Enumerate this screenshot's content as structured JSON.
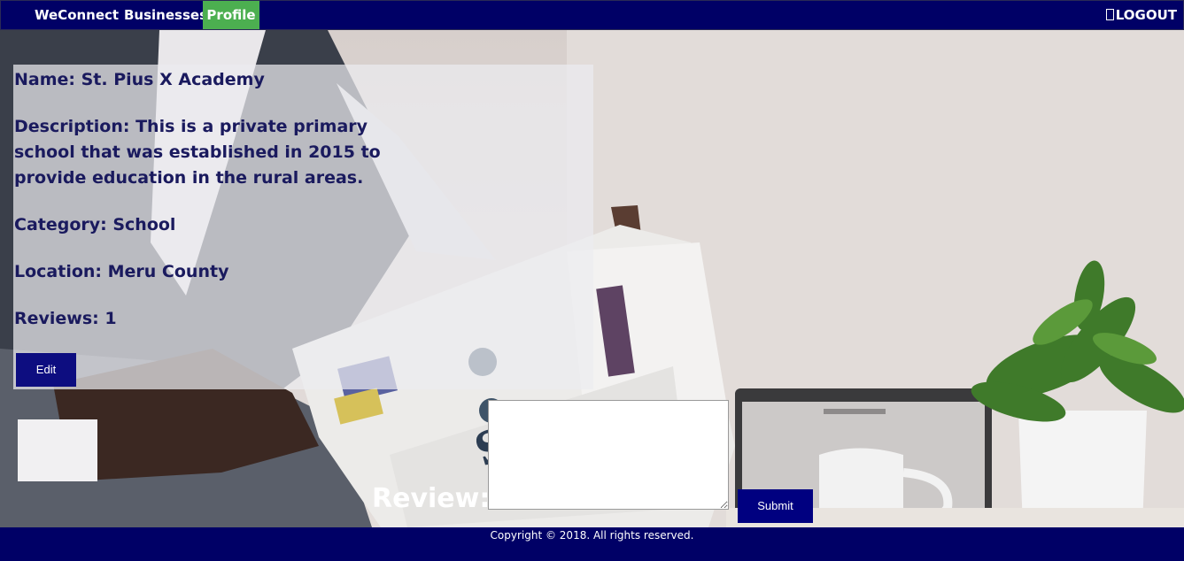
{
  "nav": {
    "brand": "WeConnect",
    "businesses": "Businesses",
    "profile": "Profile",
    "logout": "LOGOUT",
    "logout_icon": "box-glyph"
  },
  "business": {
    "name_line": "Name: St. Pius X Academy",
    "description_line": "Description: This is a private primary school that was established in 2015 to provide education in the rural areas.",
    "category_line": "Category: School",
    "location_line": "Location: Meru County",
    "reviews_line": "Reviews: 1",
    "edit_label": "Edit"
  },
  "review_form": {
    "label": "Review:",
    "textarea_value": "",
    "submit_label": "Submit"
  },
  "footer": {
    "copyright": "Copyright © 2018. All rights reserved."
  },
  "colors": {
    "nav_bg": "#000066",
    "active_tab": "#4caf50",
    "button_bg": "#000080",
    "panel_text": "#1a1a5e"
  }
}
